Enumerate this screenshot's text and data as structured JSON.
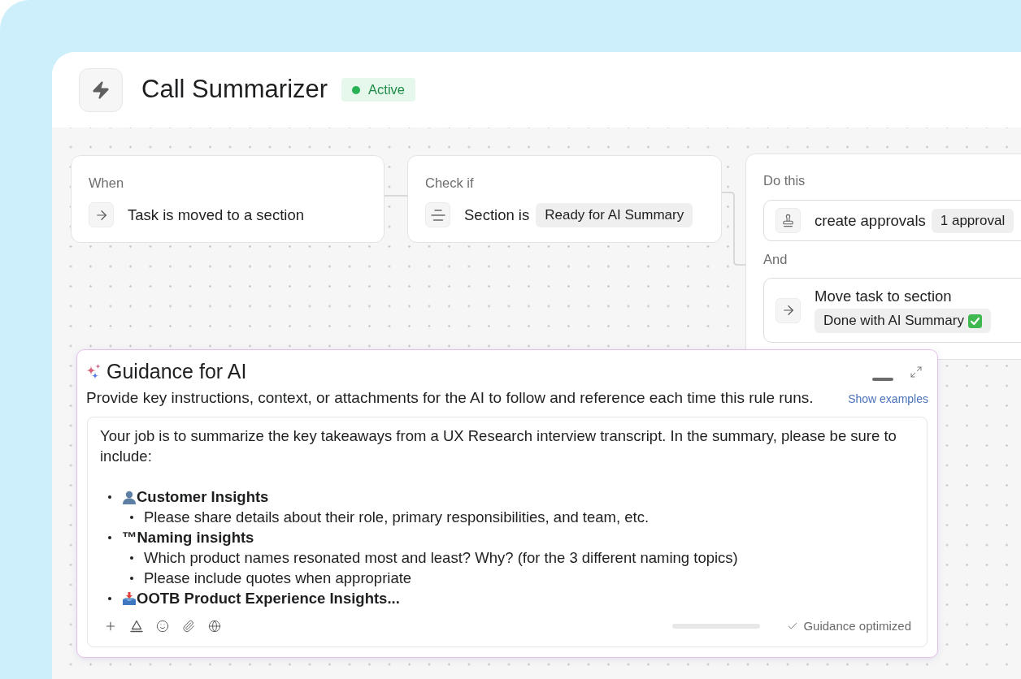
{
  "header": {
    "title": "Call Summarizer",
    "status": {
      "label": "Active",
      "active": true
    }
  },
  "workflow": {
    "trigger": {
      "label": "When",
      "text": "Task is moved to a section"
    },
    "condition": {
      "label": "Check if",
      "text": "Section is",
      "value": "Ready for AI Summary"
    },
    "actions": {
      "label": "Do this",
      "items": [
        {
          "kind": "approval",
          "text": "create approvals",
          "chip": "1 approval"
        },
        {
          "kind": "move_task",
          "joiner": "And",
          "text": "Move task to section",
          "chip": "Done with AI Summary"
        }
      ]
    }
  },
  "guidance": {
    "title": "Guidance for AI",
    "description": "Provide key instructions, context, or attachments for the AI to follow and reference each time this rule runs.",
    "link": "Show examples",
    "content": [
      {
        "kind": "paragraph",
        "text": "Your job is to summarize the key takeaways from a UX Research interview transcript. In the summary, please be sure to include:"
      },
      {
        "kind": "bullet",
        "text": "Customer Insights",
        "children": [
          {
            "text": "Please share details about their role, primary responsibilities, and team, etc."
          }
        ]
      },
      {
        "kind": "bullet",
        "text": "™Naming insights",
        "children": [
          {
            "text": "Which product names resonated most and least? Why? (for the 3 different naming topics)"
          },
          {
            "text": "Please include quotes when appropriate"
          }
        ]
      },
      {
        "kind": "bullet",
        "text": "OOTB Product Experience Insights..."
      }
    ],
    "progress": {
      "level": 1
    },
    "status": "Guidance optimized"
  }
}
